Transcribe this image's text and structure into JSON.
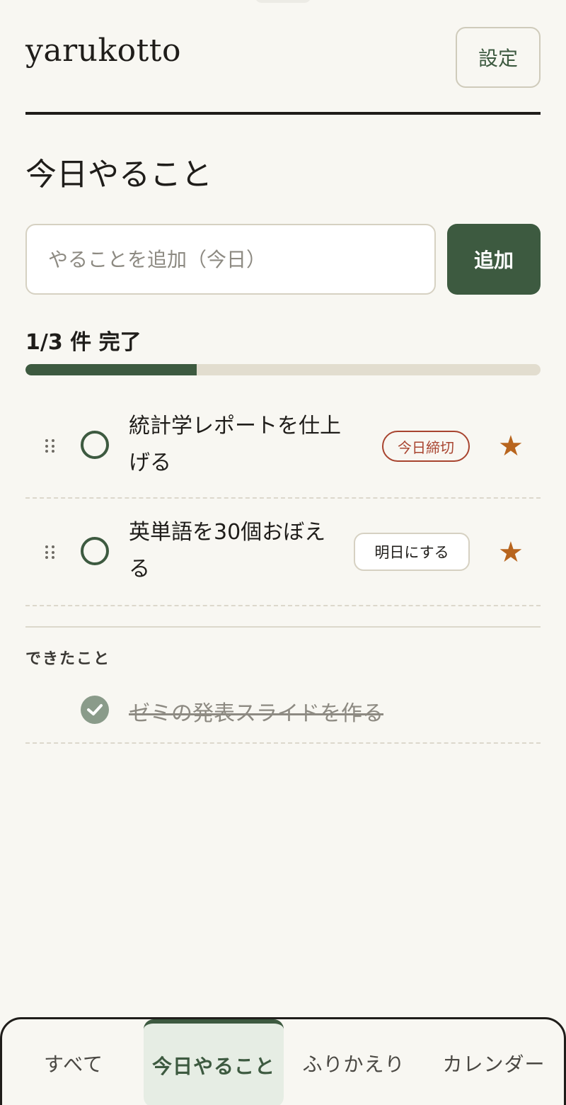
{
  "app": {
    "title": "yarukotto"
  },
  "header": {
    "settings_label": "設定"
  },
  "page": {
    "title": "今日やること"
  },
  "add_form": {
    "placeholder": "やることを追加（今日）",
    "button_label": "追加"
  },
  "progress": {
    "label": "1/3 件 完了",
    "done": 1,
    "total": 3,
    "fraction": 0.333
  },
  "tasks": [
    {
      "line1": "統計学レポートを仕上",
      "line2": "げる",
      "badge": "今日締切",
      "starred": true,
      "done": false
    },
    {
      "line1": "英単語を30個おぼえ",
      "line2": "る",
      "action": "明日にする",
      "starred": true,
      "done": false
    }
  ],
  "done_section": {
    "heading": "できたこと",
    "items": [
      {
        "text": "ゼミの発表スライドを作る",
        "done": true
      }
    ]
  },
  "nav": {
    "tabs": [
      {
        "label": "すべて",
        "active": false
      },
      {
        "label": "今日やること",
        "active": true
      },
      {
        "label": "ふりかえり",
        "active": false
      },
      {
        "label": "カレンダー",
        "active": false
      }
    ]
  },
  "colors": {
    "accent": "#3d5a40",
    "star": "#b8651e",
    "deadline": "#a8442f",
    "background": "#f8f7f2"
  },
  "icons": {
    "drag": "drag-handle-icon",
    "star": "star-icon",
    "check": "check-icon",
    "circle": "circle-icon"
  }
}
